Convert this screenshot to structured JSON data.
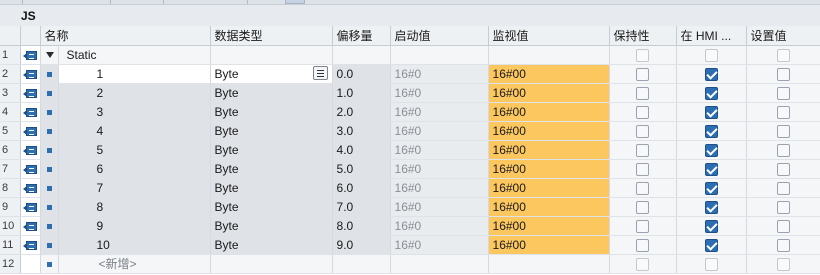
{
  "block": {
    "title": "JS"
  },
  "columns": {
    "name": "名称",
    "data_type": "数据类型",
    "offset": "偏移量",
    "start_value": "启动值",
    "monitor_value": "监视值",
    "retain": "保持性",
    "hmi": "在 HMI ...",
    "setpoint": "设置值"
  },
  "static_row": {
    "number": "1",
    "label": "Static"
  },
  "rows": [
    {
      "number": "2",
      "name": "1",
      "data_type": "Byte",
      "offset": "0.0",
      "start_value": "16#0",
      "monitor_value": "16#00",
      "retain": false,
      "hmi": true,
      "setpoint": false
    },
    {
      "number": "3",
      "name": "2",
      "data_type": "Byte",
      "offset": "1.0",
      "start_value": "16#0",
      "monitor_value": "16#00",
      "retain": false,
      "hmi": true,
      "setpoint": false
    },
    {
      "number": "4",
      "name": "3",
      "data_type": "Byte",
      "offset": "2.0",
      "start_value": "16#0",
      "monitor_value": "16#00",
      "retain": false,
      "hmi": true,
      "setpoint": false
    },
    {
      "number": "5",
      "name": "4",
      "data_type": "Byte",
      "offset": "3.0",
      "start_value": "16#0",
      "monitor_value": "16#00",
      "retain": false,
      "hmi": true,
      "setpoint": false
    },
    {
      "number": "6",
      "name": "5",
      "data_type": "Byte",
      "offset": "4.0",
      "start_value": "16#0",
      "monitor_value": "16#00",
      "retain": false,
      "hmi": true,
      "setpoint": false
    },
    {
      "number": "7",
      "name": "6",
      "data_type": "Byte",
      "offset": "5.0",
      "start_value": "16#0",
      "monitor_value": "16#00",
      "retain": false,
      "hmi": true,
      "setpoint": false
    },
    {
      "number": "8",
      "name": "7",
      "data_type": "Byte",
      "offset": "6.0",
      "start_value": "16#0",
      "monitor_value": "16#00",
      "retain": false,
      "hmi": true,
      "setpoint": false
    },
    {
      "number": "9",
      "name": "8",
      "data_type": "Byte",
      "offset": "7.0",
      "start_value": "16#0",
      "monitor_value": "16#00",
      "retain": false,
      "hmi": true,
      "setpoint": false
    },
    {
      "number": "10",
      "name": "9",
      "data_type": "Byte",
      "offset": "8.0",
      "start_value": "16#0",
      "monitor_value": "16#00",
      "retain": false,
      "hmi": true,
      "setpoint": false
    },
    {
      "number": "11",
      "name": "10",
      "data_type": "Byte",
      "offset": "9.0",
      "start_value": "16#0",
      "monitor_value": "16#00",
      "retain": false,
      "hmi": true,
      "setpoint": false
    }
  ],
  "add_row": {
    "number": "12",
    "label": "<新增>"
  },
  "icons": {
    "interface": "interface-icon",
    "member": "member-square-icon",
    "expand": "expand-triangle-icon",
    "type_picker": "list-picker-icon"
  },
  "colors": {
    "monitor_bg": "#fcc75f",
    "checkbox_checked": "#2c6db3",
    "header_bg": "#eef1f4"
  }
}
